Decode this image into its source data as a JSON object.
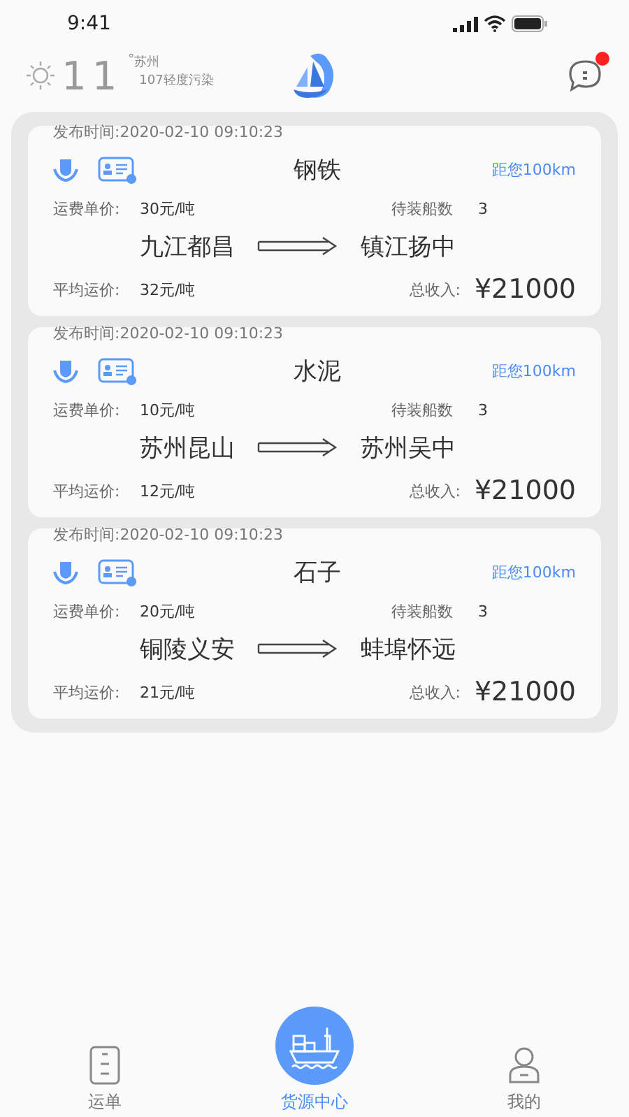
{
  "status_bar": {
    "time": "9:41"
  },
  "header": {
    "temperature": "11",
    "degree": "°",
    "city": "苏州",
    "air_quality": "107轻度污染",
    "has_notification": true
  },
  "cargo": [
    {
      "published": "发布时间:2020-02-10 09:10:23",
      "goods": "钢铁",
      "distance": "距您100km",
      "unit_price_label": "运费单价:",
      "unit_price": "30元/吨",
      "ships_label": "待装船数",
      "ships": "3",
      "from": "九江都昌",
      "to": "镇江扬中",
      "avg_label": "平均运价:",
      "avg_price": "32元/吨",
      "income_label": "总收入:",
      "income": "¥21000"
    },
    {
      "published": "发布时间:2020-02-10 09:10:23",
      "goods": "水泥",
      "distance": "距您100km",
      "unit_price_label": "运费单价:",
      "unit_price": "10元/吨",
      "ships_label": "待装船数",
      "ships": "3",
      "from": "苏州昆山",
      "to": "苏州吴中",
      "avg_label": "平均运价:",
      "avg_price": "12元/吨",
      "income_label": "总收入:",
      "income": "¥21000"
    },
    {
      "published": "发布时间:2020-02-10 09:10:23",
      "goods": "石子",
      "distance": "距您100km",
      "unit_price_label": "运费单价:",
      "unit_price": "20元/吨",
      "ships_label": "待装船数",
      "ships": "3",
      "from": "铜陵义安",
      "to": "蚌埠怀远",
      "avg_label": "平均运价:",
      "avg_price": "21元/吨",
      "income_label": "总收入:",
      "income": "¥21000"
    }
  ],
  "tab_bar": [
    {
      "kind": "orders",
      "label": "运单",
      "selected": false
    },
    {
      "kind": "cargo",
      "label": "货源中心",
      "selected": true
    },
    {
      "kind": "me",
      "label": "我的",
      "selected": false
    }
  ]
}
